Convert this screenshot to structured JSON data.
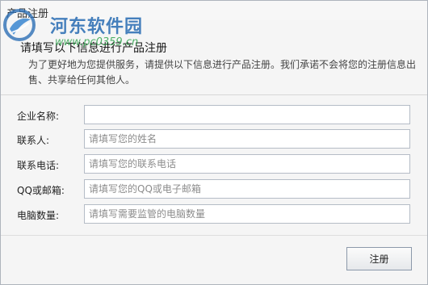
{
  "window": {
    "title": "产品注册"
  },
  "header": {
    "title": "请填写以下信息进行产品注册",
    "description": "为了更好地为您提供服务，请提供以下信息进行产品注册。我们承诺不会将您的注册信息出售、共享给任何其他人。"
  },
  "form": {
    "fields": [
      {
        "label": "企业名称:",
        "value": "",
        "placeholder": ""
      },
      {
        "label": "联系人:",
        "value": "",
        "placeholder": "请填写您的姓名"
      },
      {
        "label": "联系电话:",
        "value": "",
        "placeholder": "请填写您的联系电话"
      },
      {
        "label": "QQ或邮箱:",
        "value": "",
        "placeholder": "请填写您的QQ或电子邮箱"
      },
      {
        "label": "电脑数量:",
        "value": "",
        "placeholder": "请填写需要监管的电脑数量"
      }
    ],
    "submit_label": "注册"
  },
  "watermark": {
    "text": "河东软件园",
    "url": "www.pc0359.cn",
    "colors": {
      "text": "#2d6fb5",
      "url": "#2ca24a"
    }
  },
  "colors": {
    "window_bg": "#f5f5f5",
    "input_border": "#b5bcc6",
    "button_border": "#8c99aa",
    "placeholder": "#8c8c8c"
  }
}
